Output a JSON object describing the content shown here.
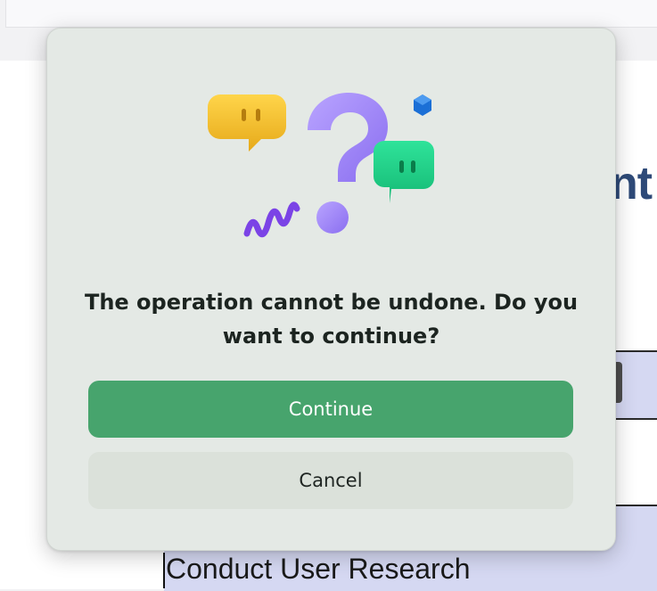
{
  "background": {
    "heading_fragment": "nt",
    "row_text": "Conduct User Research"
  },
  "dialog": {
    "illustration": "question-mark-chat-bubbles-icon",
    "message": "The operation cannot be undone. Do you want to continue?",
    "continue_label": "Continue",
    "cancel_label": "Cancel",
    "colors": {
      "dialog_bg": "#e4e9e5",
      "continue_bg": "#47a46d",
      "cancel_bg": "#dbe1da"
    }
  }
}
